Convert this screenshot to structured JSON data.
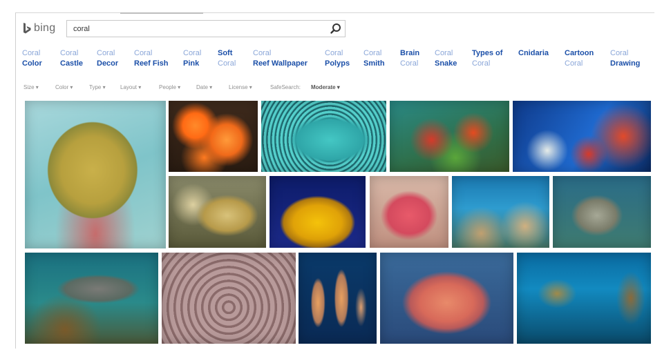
{
  "search": {
    "query": "coral",
    "placeholder": ""
  },
  "logo": {
    "text": "bing",
    "icon": "bing-b-icon"
  },
  "related": [
    {
      "l1": "Coral",
      "l2": "Color",
      "style": "lite-bold"
    },
    {
      "l1": "Coral",
      "l2": "Castle",
      "style": "lite-bold"
    },
    {
      "l1": "Coral",
      "l2": "Decor",
      "style": "lite-bold"
    },
    {
      "l1": "Coral",
      "l2": "Reef Fish",
      "style": "lite-bold"
    },
    {
      "l1": "Coral",
      "l2": "Pink",
      "style": "lite-bold"
    },
    {
      "l1": "Soft",
      "l2": "Coral",
      "style": "bold-lite"
    },
    {
      "l1": "Coral",
      "l2": "Reef Wallpaper",
      "style": "lite-bold"
    },
    {
      "l1": "Coral",
      "l2": "Polyps",
      "style": "lite-bold"
    },
    {
      "l1": "Coral",
      "l2": "Smith",
      "style": "lite-bold"
    },
    {
      "l1": "Brain",
      "l2": "Coral",
      "style": "bold-lite"
    },
    {
      "l1": "Coral",
      "l2": "Snake",
      "style": "lite-bold"
    },
    {
      "l1": "Types of",
      "l2": "Coral",
      "style": "bold-lite"
    },
    {
      "l1": "Cnidaria",
      "l2": "",
      "style": "bold-lite"
    },
    {
      "l1": "Cartoon",
      "l2": "Coral",
      "style": "bold-lite"
    },
    {
      "l1": "Coral",
      "l2": "Drawing",
      "style": "lite-bold"
    }
  ],
  "filters": [
    {
      "label": "Size ▾",
      "selected": false
    },
    {
      "label": "Color ▾",
      "selected": false
    },
    {
      "label": "Type ▾",
      "selected": false
    },
    {
      "label": "Layout ▾",
      "selected": false
    },
    {
      "label": "People ▾",
      "selected": false
    },
    {
      "label": "Date ▾",
      "selected": false
    },
    {
      "label": "License ▾",
      "selected": false
    },
    {
      "label": "SafeSearch:",
      "selected": false
    },
    {
      "label": "Moderate ▾",
      "selected": true
    }
  ],
  "images": [
    {
      "desc": "brain-coral"
    },
    {
      "desc": "orange-cup-coral"
    },
    {
      "desc": "teal-polyp-coral"
    },
    {
      "desc": "red-reef-coral"
    },
    {
      "desc": "reef-with-fish"
    },
    {
      "desc": "yellow-finger-coral"
    },
    {
      "desc": "orange-sun-coral"
    },
    {
      "desc": "pink-coral"
    },
    {
      "desc": "blue-reef"
    },
    {
      "desc": "rock-coral"
    },
    {
      "desc": "table-coral"
    },
    {
      "desc": "pillar-coral-cluster"
    },
    {
      "desc": "pillar-coral-blue"
    },
    {
      "desc": "sea-fan"
    },
    {
      "desc": "staghorn-coral"
    }
  ],
  "colors": {
    "link": "#1b4fa8",
    "link_lite": "#8aa6d8",
    "filter": "#8f8f8f",
    "bing_blue": "#00809d"
  }
}
